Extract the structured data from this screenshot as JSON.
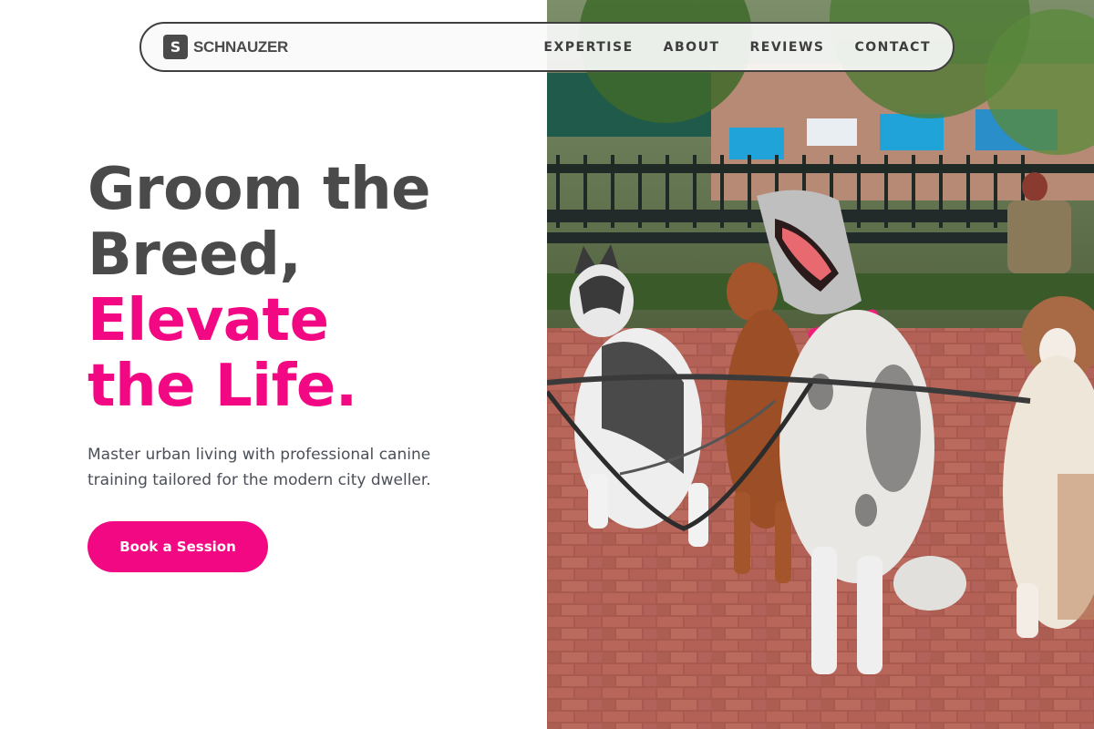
{
  "brand": {
    "mark": "S",
    "name": "SCHNAUZER"
  },
  "nav": {
    "items": [
      {
        "label": "EXPERTISE"
      },
      {
        "label": "ABOUT"
      },
      {
        "label": "REVIEWS"
      },
      {
        "label": "CONTACT"
      }
    ]
  },
  "hero": {
    "title_lines": [
      "Groom the",
      "Breed,"
    ],
    "accent_lines": [
      "Elevate",
      "the Life."
    ],
    "subtitle_lines": [
      "Master urban living with professional canine",
      "training tailored for the modern city dweller."
    ],
    "cta_label": "Book a Session"
  },
  "colors": {
    "accent": "#f20882",
    "heading": "#4a4a4a",
    "body_text": "#4b4f58",
    "nav_border": "#3f3f3f"
  },
  "icons": {
    "brand_mark": "s-logo-icon"
  },
  "image": {
    "subject": "dogs-on-leashes-city-park-photo"
  }
}
